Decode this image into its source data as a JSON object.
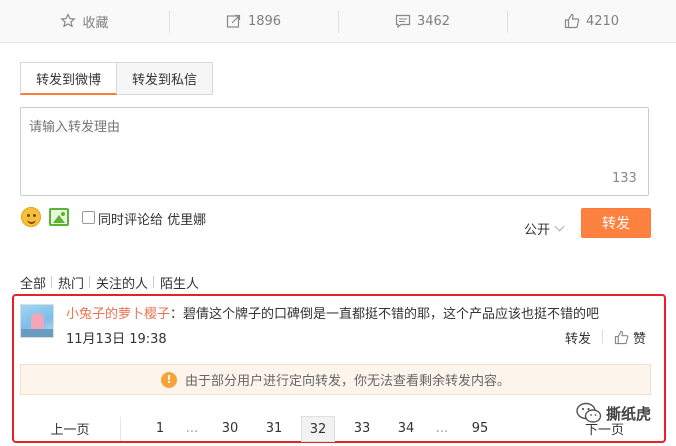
{
  "actions": {
    "favorite": {
      "label": "收藏",
      "icon": "star-icon"
    },
    "repost": {
      "label": "1896",
      "icon": "repost-icon"
    },
    "comment": {
      "label": "3462",
      "icon": "comment-icon"
    },
    "like": {
      "label": "4210",
      "icon": "thumbs-up-icon"
    }
  },
  "tabs": [
    "转发到微博",
    "转发到私信"
  ],
  "compose": {
    "placeholder": "请输入转发理由",
    "counter": "133",
    "also_comment_label": "同时评论给 优里娜",
    "visibility": "公开",
    "submit_label": "转发"
  },
  "filters": [
    "全部",
    "热门",
    "关注的人",
    "陌生人"
  ],
  "repost_item": {
    "username": "小兔子的萝卜樱子",
    "text": "：碧倩这个牌子的口碑倒是一直都挺不错的耶，这个产品应该也挺不错的吧",
    "time": "11月13日 19:38",
    "forward_label": "转发",
    "like_label": "赞"
  },
  "notice": "由于部分用户进行定向转发，你无法查看剩余转发内容。",
  "pagination": {
    "prev": "上一页",
    "pages": [
      "1",
      "...",
      "30",
      "31",
      "32",
      "33",
      "34",
      "...",
      "95"
    ],
    "current": "32",
    "next": "下一页"
  },
  "watermark": "撕纸虎",
  "colors": {
    "accent": "#ff8140",
    "username": "#eb7350",
    "highlight_border": "#e8202a",
    "notice_bg": "#fdf5ec"
  }
}
